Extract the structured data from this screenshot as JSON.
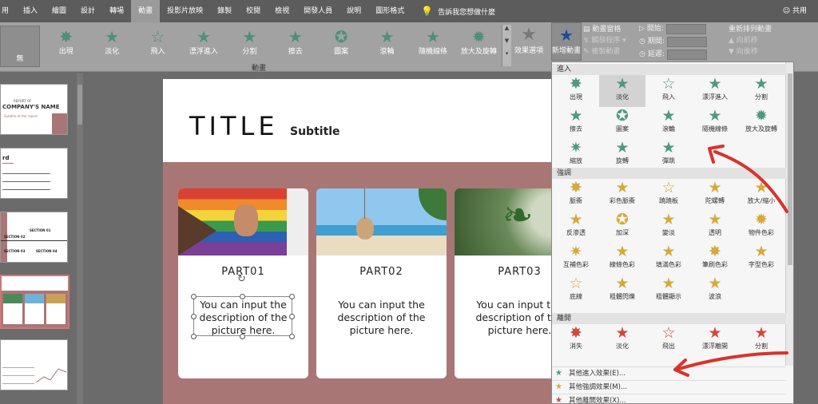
{
  "tabs": [
    {
      "label": "用"
    },
    {
      "label": "插入"
    },
    {
      "label": "繪圖"
    },
    {
      "label": "設計"
    },
    {
      "label": "轉場"
    },
    {
      "label": "動畫",
      "active": true
    },
    {
      "label": "投影片放映"
    },
    {
      "label": "錄製"
    },
    {
      "label": "校閱"
    },
    {
      "label": "檢視"
    },
    {
      "label": "開發人員"
    },
    {
      "label": "說明"
    },
    {
      "label": "圖形格式"
    }
  ],
  "tell_me": "告訴我您想做什麼",
  "share": "共用",
  "ribbon": {
    "none_label": "無",
    "gallery": [
      "出現",
      "淡化",
      "飛入",
      "漂浮進入",
      "分割",
      "擦去",
      "圖案",
      "滾輪",
      "隨機線條",
      "放大及旋轉"
    ],
    "effect_options": "效果選項",
    "group_label": "動畫",
    "add_animation": "新增動畫",
    "animation_pane": "動畫窗格",
    "trigger": "觸發程序",
    "painter": "複製動畫",
    "start_label": "開始:",
    "duration_label": "期間:",
    "delay_label": "延遲:",
    "reorder_title": "重新排列動畫",
    "move_earlier": "向前移",
    "move_later": "向後移"
  },
  "slide": {
    "title": "TITLE",
    "subtitle": "Subtitle",
    "cards": [
      {
        "part": "PART01",
        "desc": "You can input the description of the picture here."
      },
      {
        "part": "PART02",
        "desc": "You can input the description of the picture here."
      },
      {
        "part": "PART03",
        "desc": "You can input the description of the picture here."
      }
    ]
  },
  "thumbs": {
    "t1_line1": "REPORT OF",
    "t1_name": "COMPANY'S NAME",
    "t1_sub": "Subtitle of the report",
    "t2_title": "rd",
    "t3_section1": "SECTION 01",
    "t3_section2": "SECTION 02",
    "t3_section3": "SECTION 03",
    "t3_section4": "SECTION 04"
  },
  "dropdown": {
    "sections": [
      {
        "title": "進入",
        "color": "#4e9a7e",
        "items": [
          "出現",
          "淡化",
          "飛入",
          "漂浮進入",
          "分割",
          "擦去",
          "圖案",
          "滾輪",
          "隨機線條",
          "放大及旋轉",
          "縮放",
          "旋轉",
          "彈跳"
        ]
      },
      {
        "title": "強調",
        "color": "#d7a93a",
        "items": [
          "脈衝",
          "彩色脈衝",
          "蹺蹺板",
          "陀螺轉",
          "放大/縮小",
          "反渗透",
          "加深",
          "變淡",
          "透明",
          "物件色彩",
          "互補色彩",
          "線條色彩",
          "填滿色彩",
          "筆刷色彩",
          "字型色彩",
          "底線",
          "粗體閃爍",
          "粗體顯示",
          "波浪"
        ]
      },
      {
        "title": "離開",
        "color": "#d0493a",
        "items": [
          "消失",
          "淡化",
          "飛出",
          "漂浮離開",
          "分割"
        ]
      }
    ],
    "more": [
      "其他進入效果(E)...",
      "其他強調效果(M)...",
      "其他離開效果(X)..."
    ]
  },
  "colors": {
    "accent": "#a97676",
    "entrance": "#4e9a7e",
    "emphasis": "#d7a93a",
    "exit": "#d0493a",
    "annotation": "#d9322a"
  }
}
